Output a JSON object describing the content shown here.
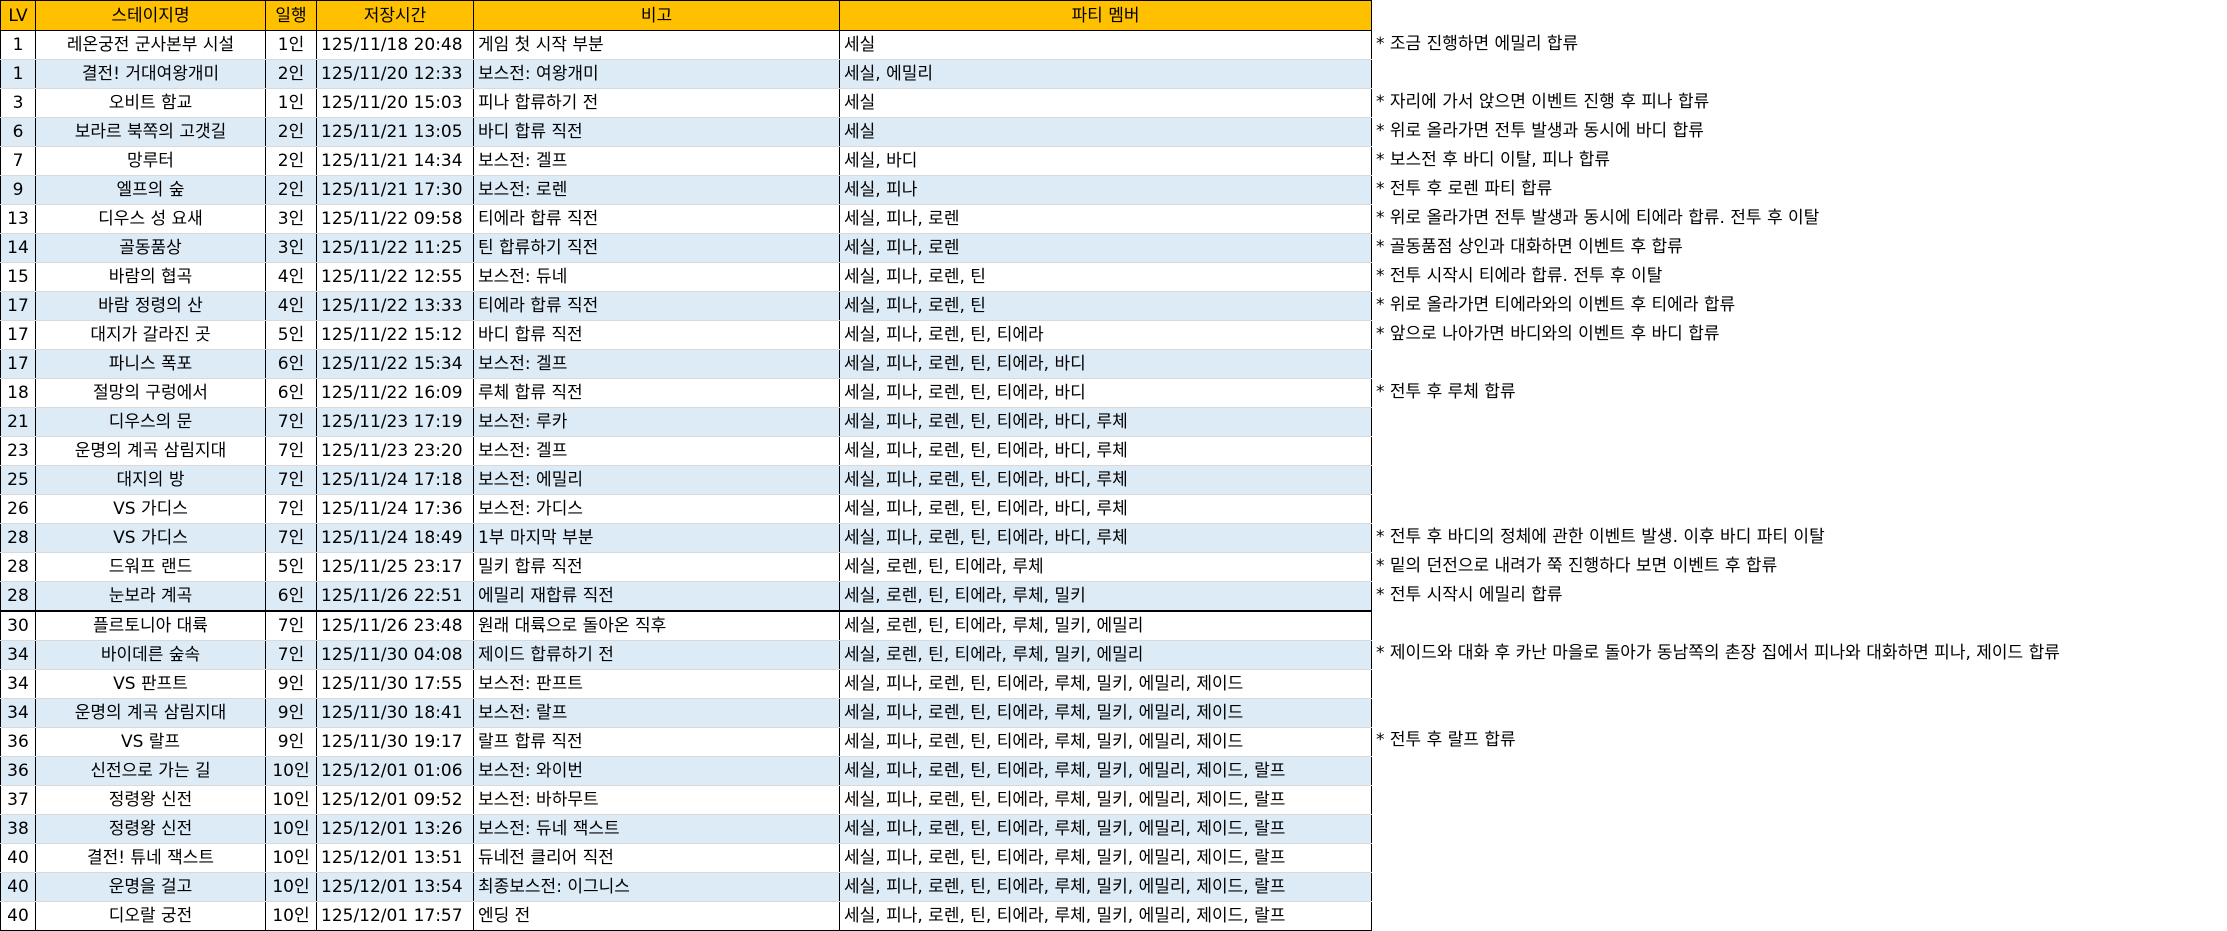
{
  "headers": {
    "lv": "LV",
    "stage": "스테이지명",
    "days": "일행",
    "time": "저장시간",
    "note": "비고",
    "party": "파티 멤버"
  },
  "rows": [
    {
      "lv": "1",
      "stage": "레온궁전 군사본부 시설",
      "days": "1인",
      "time": "125/11/18 20:48",
      "note": "게임 첫 시작 부분",
      "party": "세실",
      "extra": "* 조금 진행하면 에밀리 합류"
    },
    {
      "lv": "1",
      "stage": "결전! 거대여왕개미",
      "days": "2인",
      "time": "125/11/20 12:33",
      "note": "보스전: 여왕개미",
      "party": "세실, 에밀리",
      "extra": ""
    },
    {
      "lv": "3",
      "stage": "오비트 함교",
      "days": "1인",
      "time": "125/11/20 15:03",
      "note": "피나 합류하기 전",
      "party": "세실",
      "extra": "* 자리에 가서 앉으면 이벤트 진행 후 피나 합류"
    },
    {
      "lv": "6",
      "stage": "보라르 북쪽의 고갯길",
      "days": "2인",
      "time": "125/11/21 13:05",
      "note": "바디 합류 직전",
      "party": "세실",
      "extra": "* 위로 올라가면 전투 발생과 동시에 바디 합류"
    },
    {
      "lv": "7",
      "stage": "망루터",
      "days": "2인",
      "time": "125/11/21 14:34",
      "note": "보스전: 겔프",
      "party": "세실, 바디",
      "extra": "* 보스전 후 바디 이탈, 피나 합류"
    },
    {
      "lv": "9",
      "stage": "엘프의 숲",
      "days": "2인",
      "time": "125/11/21 17:30",
      "note": "보스전: 로렌",
      "party": "세실, 피나",
      "extra": "* 전투 후 로렌 파티 합류"
    },
    {
      "lv": "13",
      "stage": "디우스 성 요새",
      "days": "3인",
      "time": "125/11/22 09:58",
      "note": "티에라 합류 직전",
      "party": "세실, 피나, 로렌",
      "extra": "* 위로 올라가면 전투 발생과 동시에 티에라 합류. 전투 후 이탈"
    },
    {
      "lv": "14",
      "stage": "골동품상",
      "days": "3인",
      "time": "125/11/22 11:25",
      "note": "틴 합류하기 직전",
      "party": "세실, 피나, 로렌",
      "extra": "* 골동품점 상인과 대화하면 이벤트 후 합류"
    },
    {
      "lv": "15",
      "stage": "바람의 협곡",
      "days": "4인",
      "time": "125/11/22 12:55",
      "note": "보스전: 듀네",
      "party": "세실, 피나, 로렌, 틴",
      "extra": "* 전투 시작시 티에라 합류. 전투 후 이탈"
    },
    {
      "lv": "17",
      "stage": "바람 정령의 산",
      "days": "4인",
      "time": "125/11/22 13:33",
      "note": "티에라 합류 직전",
      "party": "세실, 피나, 로렌, 틴",
      "extra": "* 위로 올라가면 티에라와의 이벤트 후 티에라 합류"
    },
    {
      "lv": "17",
      "stage": "대지가 갈라진 곳",
      "days": "5인",
      "time": "125/11/22 15:12",
      "note": "바디 합류 직전",
      "party": "세실, 피나, 로렌, 틴, 티에라",
      "extra": "* 앞으로 나아가면 바디와의 이벤트 후 바디 합류"
    },
    {
      "lv": "17",
      "stage": "파니스 폭포",
      "days": "6인",
      "time": "125/11/22 15:34",
      "note": "보스전: 겔프",
      "party": "세실, 피나, 로렌, 틴, 티에라, 바디",
      "extra": ""
    },
    {
      "lv": "18",
      "stage": "절망의 구렁에서",
      "days": "6인",
      "time": "125/11/22 16:09",
      "note": "루체 합류 직전",
      "party": "세실, 피나, 로렌, 틴, 티에라, 바디",
      "extra": "* 전투 후 루체 합류"
    },
    {
      "lv": "21",
      "stage": "디우스의 문",
      "days": "7인",
      "time": "125/11/23 17:19",
      "note": "보스전: 루카",
      "party": "세실, 피나, 로렌, 틴, 티에라, 바디, 루체",
      "extra": ""
    },
    {
      "lv": "23",
      "stage": "운명의 계곡 삼림지대",
      "days": "7인",
      "time": "125/11/23 23:20",
      "note": "보스전: 겔프",
      "party": "세실, 피나, 로렌, 틴, 티에라, 바디, 루체",
      "extra": ""
    },
    {
      "lv": "25",
      "stage": "대지의 방",
      "days": "7인",
      "time": "125/11/24 17:18",
      "note": "보스전: 에밀리",
      "party": "세실, 피나, 로렌, 틴, 티에라, 바디, 루체",
      "extra": ""
    },
    {
      "lv": "26",
      "stage": "VS 가디스",
      "days": "7인",
      "time": "125/11/24 17:36",
      "note": "보스전: 가디스",
      "party": "세실, 피나, 로렌, 틴, 티에라, 바디, 루체",
      "extra": ""
    },
    {
      "lv": "28",
      "stage": "VS 가디스",
      "days": "7인",
      "time": "125/11/24 18:49",
      "note": "1부 마지막 부분",
      "party": "세실, 피나, 로렌, 틴, 티에라, 바디, 루체",
      "extra": "* 전투 후 바디의 정체에 관한 이벤트 발생. 이후 바디 파티 이탈"
    },
    {
      "lv": "28",
      "stage": "드워프 랜드",
      "days": "5인",
      "time": "125/11/25 23:17",
      "note": "밀키 합류 직전",
      "party": "세실, 로렌, 틴, 티에라, 루체",
      "extra": "* 밑의 던전으로 내려가 쭉 진행하다 보면 이벤트 후 합류"
    },
    {
      "lv": "28",
      "stage": "눈보라 계곡",
      "days": "6인",
      "time": "125/11/26 22:51",
      "note": "에밀리 재합류 직전",
      "party": "세실, 로렌, 틴, 티에라, 루체, 밀키",
      "extra": "* 전투 시작시 에밀리 합류"
    },
    {
      "lv": "30",
      "stage": "플르토니아 대륙",
      "days": "7인",
      "time": "125/11/26 23:48",
      "note": "원래 대륙으로 돌아온 직후",
      "party": "세실, 로렌, 틴, 티에라, 루체, 밀키, 에밀리",
      "extra": ""
    },
    {
      "lv": "34",
      "stage": "바이데른 숲속",
      "days": "7인",
      "time": "125/11/30 04:08",
      "note": "제이드 합류하기 전",
      "party": "세실, 로렌, 틴, 티에라, 루체, 밀키, 에밀리",
      "extra": "* 제이드와 대화 후 카난 마을로 돌아가 동남쪽의 촌장 집에서 피나와 대화하면 피나, 제이드 합류"
    },
    {
      "lv": "34",
      "stage": "VS 판프트",
      "days": "9인",
      "time": "125/11/30 17:55",
      "note": "보스전: 판프트",
      "party": "세실, 피나, 로렌, 틴, 티에라, 루체, 밀키, 에밀리, 제이드",
      "extra": ""
    },
    {
      "lv": "34",
      "stage": "운명의 계곡 삼림지대",
      "days": "9인",
      "time": "125/11/30 18:41",
      "note": "보스전: 랄프",
      "party": "세실, 피나, 로렌, 틴, 티에라, 루체, 밀키, 에밀리, 제이드",
      "extra": ""
    },
    {
      "lv": "36",
      "stage": "VS 랄프",
      "days": "9인",
      "time": "125/11/30 19:17",
      "note": "랄프 합류 직전",
      "party": "세실, 피나, 로렌, 틴, 티에라, 루체, 밀키, 에밀리, 제이드",
      "extra": "* 전투 후 랄프 합류"
    },
    {
      "lv": "36",
      "stage": "신전으로 가는 길",
      "days": "10인",
      "time": "125/12/01 01:06",
      "note": "보스전: 와이번",
      "party": "세실, 피나, 로렌, 틴, 티에라, 루체, 밀키, 에밀리, 제이드, 랄프",
      "extra": ""
    },
    {
      "lv": "37",
      "stage": "정령왕 신전",
      "days": "10인",
      "time": "125/12/01 09:52",
      "note": "보스전: 바하무트",
      "party": "세실, 피나, 로렌, 틴, 티에라, 루체, 밀키, 에밀리, 제이드, 랄프",
      "extra": ""
    },
    {
      "lv": "38",
      "stage": "정령왕 신전",
      "days": "10인",
      "time": "125/12/01 13:26",
      "note": "보스전: 듀네 잭스트",
      "party": "세실, 피나, 로렌, 틴, 티에라, 루체, 밀키, 에밀리, 제이드, 랄프",
      "extra": ""
    },
    {
      "lv": "40",
      "stage": "결전! 튜네 잭스트",
      "days": "10인",
      "time": "125/12/01 13:51",
      "note": "듀네전 클리어 직전",
      "party": "세실, 피나, 로렌, 틴, 티에라, 루체, 밀키, 에밀리, 제이드, 랄프",
      "extra": ""
    },
    {
      "lv": "40",
      "stage": "운명을 걸고",
      "days": "10인",
      "time": "125/12/01 13:54",
      "note": "최종보스전: 이그니스",
      "party": "세실, 피나, 로렌, 틴, 티에라, 루체, 밀키, 에밀리, 제이드, 랄프",
      "extra": ""
    },
    {
      "lv": "40",
      "stage": "디오랄 궁전",
      "days": "10인",
      "time": "125/12/01 17:57",
      "note": "엔딩 전",
      "party": "세실, 피나, 로렌, 틴, 티에라, 루체, 밀키, 에밀리, 제이드, 랄프",
      "extra": ""
    }
  ],
  "colors": {
    "header_bg": "#ffc000",
    "alt_row_bg": "#ddebf7",
    "border": "#000000"
  }
}
